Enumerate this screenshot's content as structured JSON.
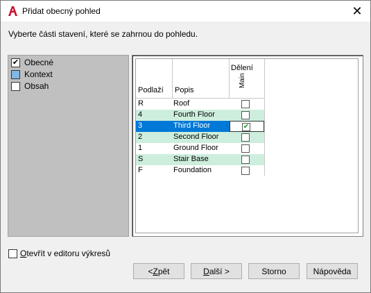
{
  "window": {
    "title": "Přidat obecný pohled",
    "accent_color": "#0078d7"
  },
  "instruction": "Vyberte části stavení, které se zahrnou do pohledu.",
  "parts": [
    {
      "label": "Obecné",
      "checked": true,
      "color": "#ffffff"
    },
    {
      "label": "Kontext",
      "checked": false,
      "color": "#7fb7e6"
    },
    {
      "label": "Obsah",
      "checked": false,
      "color": "#ffffff"
    }
  ],
  "grid": {
    "group_header": "Dělení",
    "col_level": "Podlaží",
    "col_desc": "Popis",
    "col_main": "Main",
    "rows": [
      {
        "level": "R",
        "desc": "Roof",
        "checked": false,
        "shade": "none"
      },
      {
        "level": "4",
        "desc": "Fourth Floor",
        "checked": false,
        "shade": "green"
      },
      {
        "level": "3",
        "desc": "Third Floor",
        "checked": true,
        "shade": "selected"
      },
      {
        "level": "2",
        "desc": "Second Floor",
        "checked": false,
        "shade": "green"
      },
      {
        "level": "1",
        "desc": "Ground Floor",
        "checked": false,
        "shade": "none"
      },
      {
        "level": "S",
        "desc": "Stair Base",
        "checked": false,
        "shade": "green"
      },
      {
        "level": "F",
        "desc": "Foundation",
        "checked": false,
        "shade": "none"
      }
    ]
  },
  "open_in_editor": {
    "prefix": "O",
    "rest": "tevřít v editoru výkresů",
    "checked": false
  },
  "buttons": {
    "back": {
      "prefix": "< ",
      "mnemonic": "Z",
      "rest": "pět"
    },
    "next": {
      "mnemonic": "D",
      "rest": "alší >"
    },
    "cancel": "Storno",
    "help": "Nápověda"
  }
}
